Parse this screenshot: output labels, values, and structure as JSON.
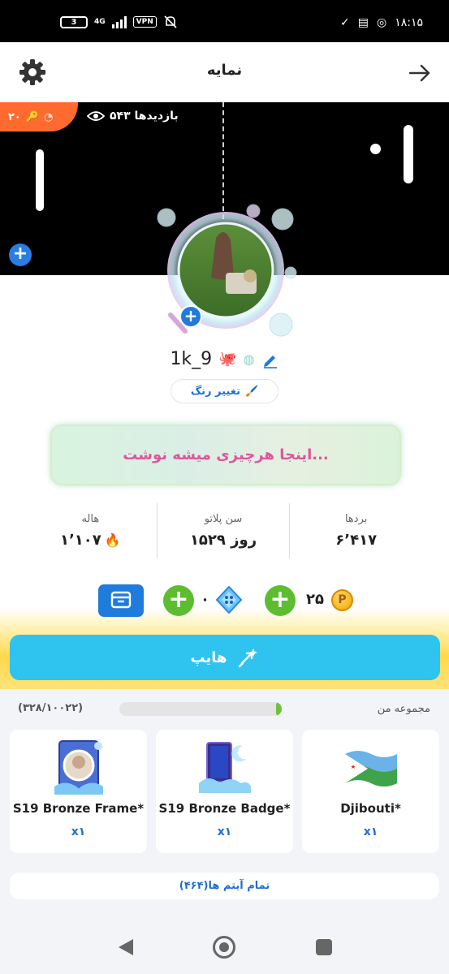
{
  "status_bar": {
    "battery": "3",
    "network": "4G",
    "vpn": "VPN",
    "time": "۱۸:۱۵"
  },
  "header": {
    "title": "نمایه"
  },
  "cover": {
    "event_value": "۲۰",
    "views_label": "۵۴۳ بازدیدها"
  },
  "profile": {
    "username": "1k_9",
    "change_color_label": "تغییر رنگ",
    "bio": "اینجا هرچیزی میشه نوشت..."
  },
  "stats": [
    {
      "label": "بردها",
      "value": "۶٬۴۱۷"
    },
    {
      "label": "سن پلاتو",
      "value": "۱۵۲۹ روز"
    },
    {
      "label": "هاله",
      "value": "۱٬۱۰۷"
    }
  ],
  "currency": {
    "coins": "۲۵",
    "gems": "۰"
  },
  "hype": {
    "label": "هایپ"
  },
  "collection": {
    "title": "مجموعه من",
    "count": "(۳۲۸/۱۰۰۲۲)",
    "progress": 0.033,
    "items": [
      {
        "name": "Djibouti*",
        "qty": "x۱"
      },
      {
        "name": "S19 Bronze Badge*",
        "qty": "x۱"
      },
      {
        "name": "S19 Bronze Frame*",
        "qty": "x۱"
      }
    ],
    "all_items_label": "تمام آیتم ها(۴۶۴)"
  },
  "colors": {
    "accent_blue": "#1f7bdc",
    "hype_cyan": "#2ec4ef",
    "green": "#5cbd31",
    "bio_pink": "#e0559a",
    "event_orange": "#ff6a2e"
  },
  "icons": [
    "gear-icon",
    "back-arrow-icon",
    "eye-icon",
    "edit-icon",
    "brush-icon",
    "coin-icon",
    "gem-icon",
    "wallet-icon",
    "hype-icon"
  ]
}
